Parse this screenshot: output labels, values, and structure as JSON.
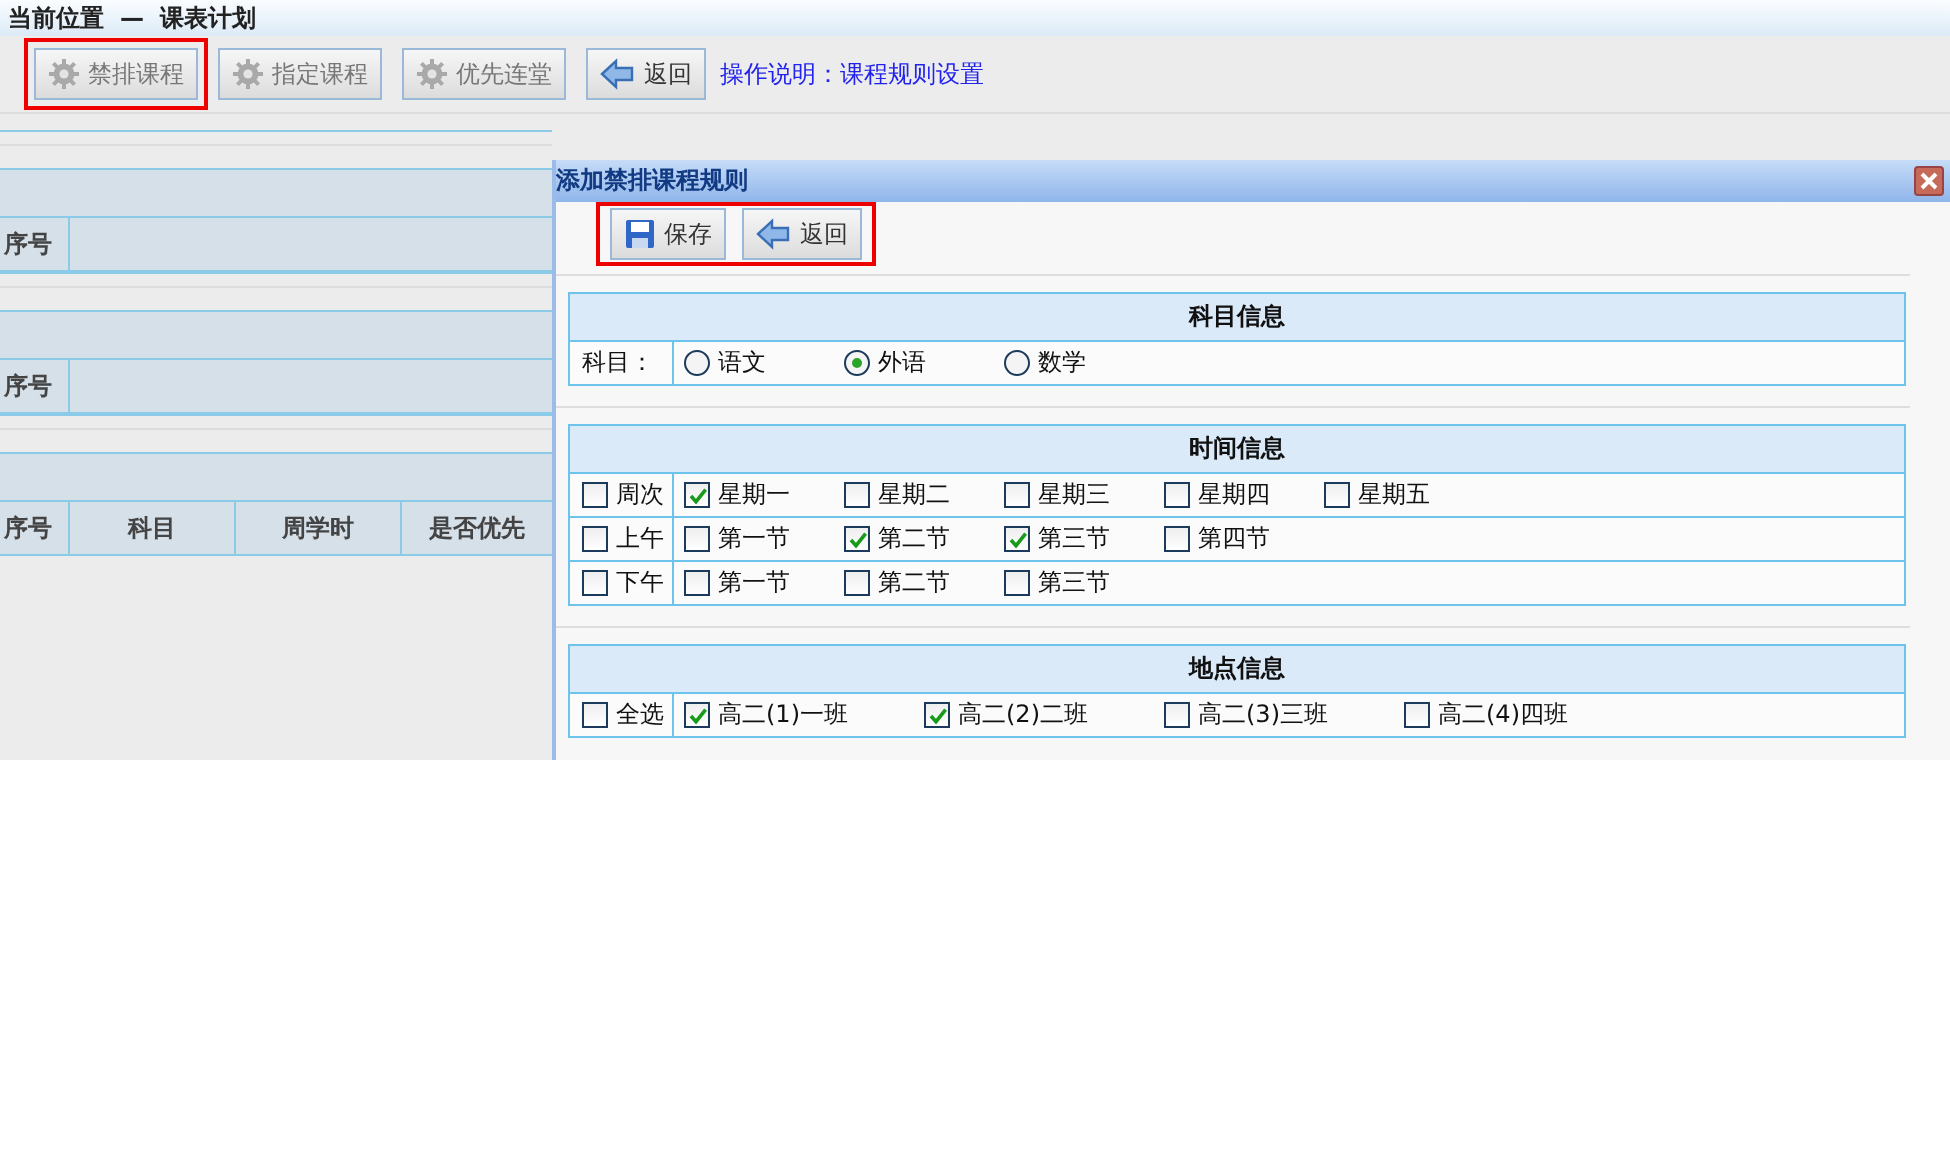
{
  "breadcrumb": {
    "label": "当前位置",
    "separator": "—",
    "current": "课表计划"
  },
  "toolbar": {
    "buttons": [
      {
        "label": "禁排课程",
        "kind": "action",
        "highlighted": true
      },
      {
        "label": "指定课程",
        "kind": "action",
        "highlighted": false
      },
      {
        "label": "优先连堂",
        "kind": "action",
        "highlighted": false
      },
      {
        "label": "返回",
        "kind": "back",
        "highlighted": false
      }
    ],
    "help_link": "操作说明：课程规则设置"
  },
  "left_panel": {
    "tables": [
      {
        "columns": [
          "序号"
        ]
      },
      {
        "columns": [
          "序号"
        ]
      },
      {
        "columns": [
          "序号",
          "科目",
          "周学时",
          "是否优先"
        ]
      }
    ]
  },
  "dialog": {
    "title": "添加禁排课程规则",
    "buttons_highlighted": true,
    "buttons": [
      {
        "label": "保存",
        "kind": "save"
      },
      {
        "label": "返回",
        "kind": "back"
      }
    ],
    "sections": [
      {
        "title": "科目信息",
        "kind": "subject",
        "rows": [
          {
            "head": {
              "kind": "text",
              "label": "科目："
            },
            "options": [
              {
                "kind": "radio",
                "label": "语文",
                "selected": false
              },
              {
                "kind": "radio",
                "label": "外语",
                "selected": true
              },
              {
                "kind": "radio",
                "label": "数学",
                "selected": false
              }
            ]
          }
        ]
      },
      {
        "title": "时间信息",
        "kind": "time",
        "rows": [
          {
            "head": {
              "kind": "checkbox",
              "label": "周次",
              "checked": false
            },
            "options": [
              {
                "kind": "checkbox",
                "label": "星期一",
                "checked": true
              },
              {
                "kind": "checkbox",
                "label": "星期二",
                "checked": false
              },
              {
                "kind": "checkbox",
                "label": "星期三",
                "checked": false
              },
              {
                "kind": "checkbox",
                "label": "星期四",
                "checked": false
              },
              {
                "kind": "checkbox",
                "label": "星期五",
                "checked": false
              }
            ]
          },
          {
            "head": {
              "kind": "checkbox",
              "label": "上午",
              "checked": false
            },
            "options": [
              {
                "kind": "checkbox",
                "label": "第一节",
                "checked": false
              },
              {
                "kind": "checkbox",
                "label": "第二节",
                "checked": true
              },
              {
                "kind": "checkbox",
                "label": "第三节",
                "checked": true
              },
              {
                "kind": "checkbox",
                "label": "第四节",
                "checked": false
              }
            ]
          },
          {
            "head": {
              "kind": "checkbox",
              "label": "下午",
              "checked": false
            },
            "options": [
              {
                "kind": "checkbox",
                "label": "第一节",
                "checked": false
              },
              {
                "kind": "checkbox",
                "label": "第二节",
                "checked": false
              },
              {
                "kind": "checkbox",
                "label": "第三节",
                "checked": false
              }
            ]
          }
        ]
      },
      {
        "title": "地点信息",
        "kind": "location",
        "rows": [
          {
            "head": {
              "kind": "checkbox",
              "label": "全选",
              "checked": false
            },
            "options": [
              {
                "kind": "checkbox",
                "label": "高二(1)一班",
                "checked": true
              },
              {
                "kind": "checkbox",
                "label": "高二(2)二班",
                "checked": true
              },
              {
                "kind": "checkbox",
                "label": "高二(3)三班",
                "checked": false
              },
              {
                "kind": "checkbox",
                "label": "高二(4)四班",
                "checked": false
              }
            ]
          }
        ]
      }
    ]
  }
}
